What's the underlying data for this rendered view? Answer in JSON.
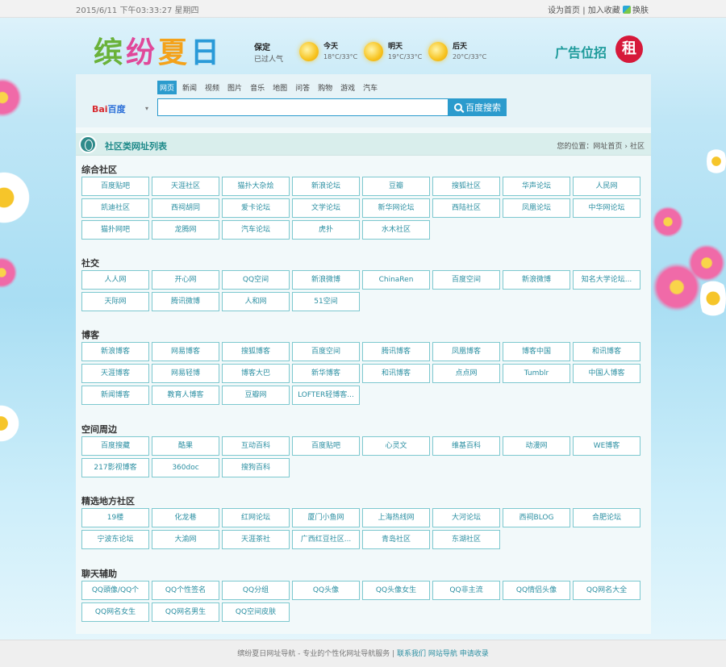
{
  "topbar": {
    "datetime": "2015/6/11 下午03:33:27 星期四",
    "set_home": "设为首页",
    "add_favorite": "加入收藏",
    "sep": "|",
    "skin": "换肤"
  },
  "logo": {
    "c1": "缤",
    "c2": "纷",
    "c3": "夏",
    "c4": "日"
  },
  "weather": {
    "city": "保定",
    "status": "已过人气",
    "days": [
      {
        "label": "今天",
        "temp": "18°C/33°C"
      },
      {
        "label": "明天",
        "temp": "19°C/33°C"
      },
      {
        "label": "后天",
        "temp": "20°C/33°C"
      }
    ]
  },
  "ad": {
    "text": "广告位招",
    "badge": "租"
  },
  "search": {
    "tabs": [
      "网页",
      "新闻",
      "视频",
      "图片",
      "音乐",
      "地图",
      "问答",
      "购物",
      "游戏",
      "汽车"
    ],
    "active_tab": 0,
    "engine_b1": "Bai",
    "engine_b2": "百度",
    "caret": "▾",
    "input_value": "",
    "button": "百度搜索"
  },
  "list_header": {
    "title": "社区类网址列表",
    "crumb_prefix": "您的位置：",
    "crumb_home": "网址首页",
    "crumb_sep": "›",
    "crumb_current": "社区"
  },
  "sections": [
    {
      "title": "综合社区",
      "items": [
        "百度贴吧",
        "天涯社区",
        "猫扑大杂烩",
        "新浪论坛",
        "豆瓣",
        "搜狐社区",
        "华声论坛",
        "人民网",
        "凯迪社区",
        "西祠胡同",
        "爱卡论坛",
        "文学论坛",
        "新华网论坛",
        "西陆社区",
        "凤凰论坛",
        "中华网论坛",
        "猫扑网吧",
        "龙腾网",
        "汽车论坛",
        "虎扑",
        "水木社区"
      ]
    },
    {
      "title": "社交",
      "items": [
        "人人网",
        "开心网",
        "QQ空间",
        "新浪微博",
        "ChinaRen",
        "百度空间",
        "新浪微博",
        "知名大学论坛...",
        "天际网",
        "腾讯微博",
        "人和网",
        "51空间"
      ]
    },
    {
      "title": "博客",
      "items": [
        "新浪博客",
        "网易博客",
        "搜狐博客",
        "百度空间",
        "腾讯博客",
        "凤凰博客",
        "博客中国",
        "和讯博客",
        "天涯博客",
        "网易轻博",
        "博客大巴",
        "新华博客",
        "和讯博客",
        "点点网",
        "Tumblr",
        "中国人博客",
        "新闻博客",
        "教育人博客",
        "豆瓣网",
        "LOFTER轻博客..."
      ]
    },
    {
      "title": "空间周边",
      "items": [
        "百度搜藏",
        "酷果",
        "互动百科",
        "百度贴吧",
        "心灵文",
        "维基百科",
        "动漫网",
        "WE博客",
        "217影视博客",
        "360doc",
        "搜狗百科"
      ]
    },
    {
      "title": "精选地方社区",
      "items": [
        "19楼",
        "化龙巷",
        "红网论坛",
        "厦门小鱼网",
        "上海热线网",
        "大河论坛",
        "西祠BLOG",
        "合肥论坛",
        "宁波东论坛",
        "大渝网",
        "天涯茶社",
        "广西红豆社区...",
        "青岛社区",
        "东湖社区"
      ]
    },
    {
      "title": "聊天辅助",
      "items": [
        "QQ頭像/QQ个",
        "QQ个性签名",
        "QQ分组",
        "QQ头像",
        "QQ头像女生",
        "QQ非主流",
        "QQ情侣头像",
        "QQ网名大全",
        "QQ网名女生",
        "QQ网名男生",
        "QQ空间皮肤"
      ]
    }
  ],
  "footer": {
    "text": "缤纷夏日网址导航 - 专业的个性化网址导航服务",
    "sep": " | ",
    "lnk1": "联系我们",
    "lnk2": "网站导航",
    "lnk3": "申请收录"
  }
}
